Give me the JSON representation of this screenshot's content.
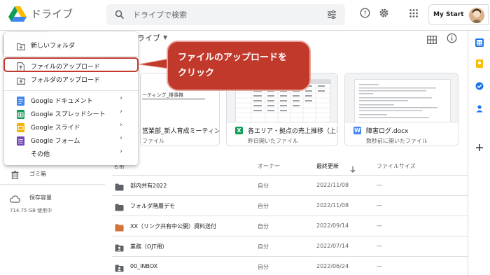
{
  "app": {
    "brand": "ドライブ"
  },
  "search": {
    "placeholder": "ドライブで検索"
  },
  "account": {
    "label": "My Start"
  },
  "breadcrumb": {
    "label": "ライブ"
  },
  "new_menu": {
    "items": [
      {
        "label": "新しいフォルダ",
        "icon": "new-folder-icon"
      },
      {
        "label": "ファイルのアップロード",
        "icon": "file-upload-icon"
      },
      {
        "label": "フォルダのアップロード",
        "icon": "folder-upload-icon"
      },
      {
        "label": "Google ドキュメント",
        "icon": "docs-icon",
        "color": "#4285f4"
      },
      {
        "label": "Google スプレッドシート",
        "icon": "sheets-icon",
        "color": "#0f9d58"
      },
      {
        "label": "Google スライド",
        "icon": "slides-icon",
        "color": "#f4b400"
      },
      {
        "label": "Google フォーム",
        "icon": "forms-icon",
        "color": "#7248b9"
      },
      {
        "label": "その他",
        "icon": ""
      }
    ]
  },
  "callout": {
    "text": "ファイルのアップロードをクリック",
    "line1": "ファイルのアップロードを",
    "line2": "クリック",
    "color": "#c0392b"
  },
  "sidebar": {
    "trash": "ゴミ箱",
    "storage": "保存容量",
    "storage_used": "714.75 GB 使用中"
  },
  "suggested": [
    {
      "title": "営業部_新人育成ミーティング...",
      "sub": "ファイル",
      "icon": "",
      "preview_text": "ーティング_推事推"
    },
    {
      "title": "各エリア・拠点の売上推移（上半...",
      "sub": "昨日開いたファイル",
      "icon": "X",
      "icon_color": "#0f9d58"
    },
    {
      "title": "障害ログ.docx",
      "sub": "数秒前に開いたファイル",
      "icon": "W",
      "icon_color": "#4285f4"
    }
  ],
  "table": {
    "headers": {
      "name": "名前",
      "owner": "オーナー",
      "modified": "最終更新",
      "size": "ファイルサイズ"
    },
    "rows": [
      {
        "name": "部内共有2022",
        "owner": "自分",
        "date": "2022/11/08",
        "size": "—",
        "icon": "folder-icon"
      },
      {
        "name": "フォルダ階層デモ",
        "owner": "自分",
        "date": "2022/11/08",
        "size": "—",
        "icon": "folder-icon"
      },
      {
        "name": "XX（リンク共有中公開）資料送付",
        "owner": "自分",
        "date": "2022/09/14",
        "size": "—",
        "icon": "shared-folder-icon"
      },
      {
        "name": "業務（OJT用）",
        "owner": "自分",
        "date": "2022/07/14",
        "size": "—",
        "icon": "shared-folder-icon"
      },
      {
        "name": "00_INBOX",
        "owner": "自分",
        "date": "2022/06/24",
        "size": "—",
        "icon": "shared-folder-icon"
      }
    ]
  }
}
